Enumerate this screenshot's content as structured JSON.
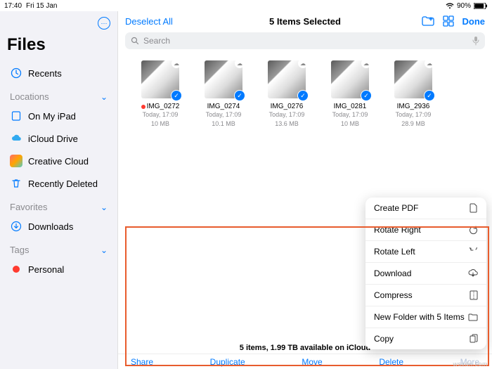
{
  "status": {
    "time": "17:40",
    "date": "Fri 15 Jan",
    "wifi": "􀙇",
    "battery_pct": "90%"
  },
  "sidebar": {
    "title": "Files",
    "recents": "Recents",
    "section_locations": "Locations",
    "items_loc": [
      {
        "label": "On My iPad"
      },
      {
        "label": "iCloud Drive"
      },
      {
        "label": "Creative Cloud"
      },
      {
        "label": "Recently Deleted"
      }
    ],
    "section_fav": "Favorites",
    "items_fav": [
      {
        "label": "Downloads"
      }
    ],
    "section_tags": "Tags",
    "items_tags": [
      {
        "label": "Personal"
      }
    ]
  },
  "header": {
    "deselect": "Deselect All",
    "title": "5 Items Selected",
    "done": "Done"
  },
  "search_placeholder": "Search",
  "files": [
    {
      "name": "IMG_0272",
      "meta": "Today, 17:09",
      "size": "10 MB",
      "rec": true
    },
    {
      "name": "IMG_0274",
      "meta": "Today, 17:09",
      "size": "10.1 MB",
      "rec": false
    },
    {
      "name": "IMG_0276",
      "meta": "Today, 17:09",
      "size": "13.6 MB",
      "rec": false
    },
    {
      "name": "IMG_0281",
      "meta": "Today, 17:09",
      "size": "10 MB",
      "rec": false
    },
    {
      "name": "IMG_2936",
      "meta": "Today, 17:09",
      "size": "28.9 MB",
      "rec": false
    }
  ],
  "status_line": "5 items, 1.99 TB available on iCloud",
  "toolbar": {
    "share": "Share",
    "duplicate": "Duplicate",
    "move": "Move",
    "delete": "Delete",
    "more": "More"
  },
  "popover": [
    {
      "label": "Create PDF"
    },
    {
      "label": "Rotate Right"
    },
    {
      "label": "Rotate Left"
    },
    {
      "label": "Download"
    },
    {
      "label": "Compress"
    },
    {
      "label": "New Folder with 5 Items"
    },
    {
      "label": "Copy"
    }
  ],
  "watermark": "wsxdn.com"
}
